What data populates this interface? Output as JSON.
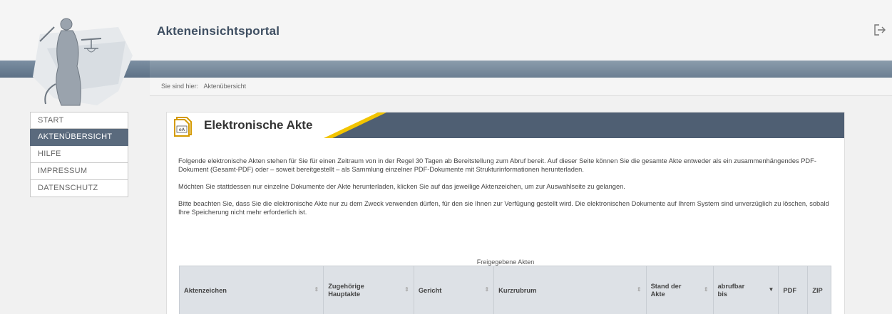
{
  "app": {
    "title": "Akteneinsichtsportal"
  },
  "breadcrumb": {
    "prefix": "Sie sind hier:",
    "current": "Aktenübersicht"
  },
  "sidebar": {
    "items": [
      {
        "label": "START",
        "active": false
      },
      {
        "label": "AKTENÜBERSICHT",
        "active": true
      },
      {
        "label": "HILFE",
        "active": false
      },
      {
        "label": "IMPRESSUM",
        "active": false
      },
      {
        "label": "DATENSCHUTZ",
        "active": false
      }
    ]
  },
  "panel": {
    "icon_text": "eA",
    "title": "Elektronische Akte",
    "paragraphs": [
      "Folgende elektronische Akten stehen für Sie für einen Zeitraum von in der Regel 30 Tagen ab Bereitstellung zum Abruf bereit. Auf dieser Seite können Sie die gesamte Akte entweder als ein zusammenhängendes PDF-Dokument (Gesamt-PDF) oder – soweit bereitgestellt – als Sammlung einzelner PDF-Dokumente mit Strukturinformationen herunterladen.",
      "Möchten Sie stattdessen nur einzelne Dokumente der Akte herunterladen, klicken Sie auf das jeweilige Aktenzeichen, um zur Auswahlseite zu gelangen.",
      "Bitte beachten Sie, dass Sie die elektronische Akte nur zu dem Zweck verwenden dürfen, für den sie Ihnen zur Verfügung gestellt wird. Die elektronischen Dokumente auf Ihrem System sind unverzüglich zu löschen, sobald Ihre Speicherung nicht mehr erforderlich ist."
    ]
  },
  "table": {
    "caption": "Freigegebene Akten",
    "columns": [
      {
        "label": "Aktenzeichen",
        "sortable": true,
        "sorted": false
      },
      {
        "label": "Zugehörige Hauptakte",
        "sortable": true,
        "sorted": false
      },
      {
        "label": "Gericht",
        "sortable": true,
        "sorted": false
      },
      {
        "label": "Kurzrubrum",
        "sortable": true,
        "sorted": false
      },
      {
        "label": "Stand der Akte",
        "sortable": true,
        "sorted": false
      },
      {
        "label": "abrufbar bis",
        "sortable": true,
        "sorted": true
      },
      {
        "label": "PDF",
        "sortable": false,
        "sorted": false
      },
      {
        "label": "ZIP",
        "sortable": false,
        "sorted": false
      }
    ]
  },
  "colors": {
    "header_band": "#6c7f92",
    "active_nav": "#5a6a7d",
    "panel_header": "#4f5f73",
    "accent_stripe": "#f2c400"
  },
  "icons": {
    "logo": "justitia-logo",
    "logout": "logout-icon",
    "panel": "ea-document-icon",
    "sort": "sort-icon"
  }
}
